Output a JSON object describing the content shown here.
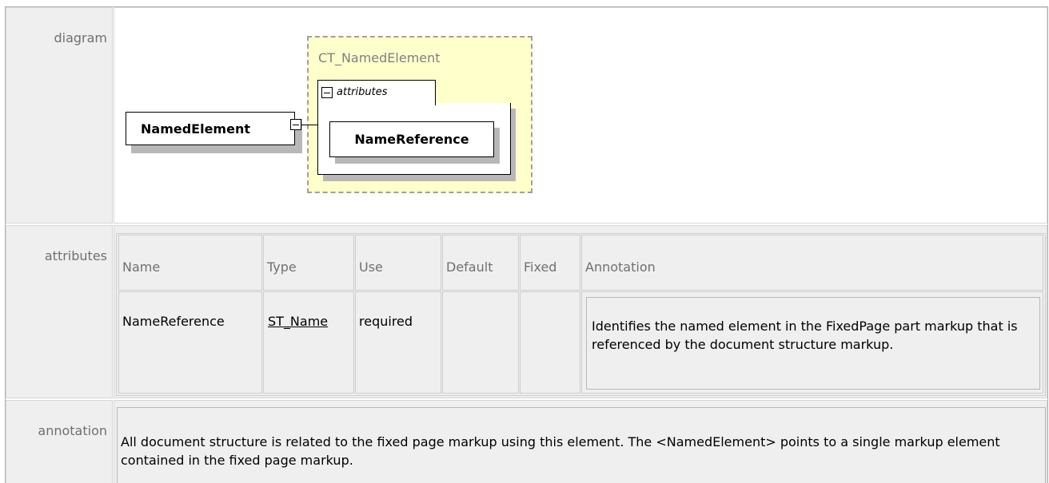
{
  "sections": {
    "diagram_label": "diagram",
    "attributes_label": "attributes",
    "annotation_label": "annotation"
  },
  "diagram": {
    "element_name": "NamedElement",
    "complex_type": "CT_NamedElement",
    "attributes_group": "attributes",
    "attribute_name": "NameReference"
  },
  "attributes_table": {
    "headers": [
      "Name",
      "Type",
      "Use",
      "Default",
      "Fixed",
      "Annotation"
    ],
    "rows": [
      {
        "name": "NameReference",
        "type": "ST_Name",
        "use": "required",
        "default": "",
        "fixed": "",
        "annotation": "Identifies the named element in the FixedPage part markup that is referenced by the document structure markup."
      }
    ]
  },
  "annotation": {
    "text": "All document structure is related to the fixed page markup using this element. The <NamedElement> points to a single markup element contained in the fixed page markup."
  }
}
